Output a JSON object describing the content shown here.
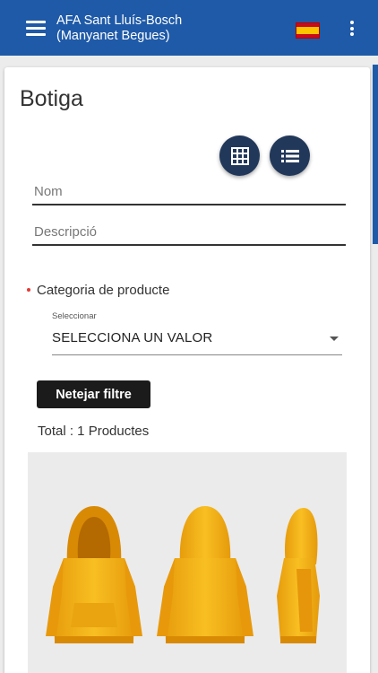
{
  "appbar": {
    "title_line1": "AFA Sant Lluís-Bosch",
    "title_line2": "(Manyanet Begues)",
    "flag_icon": "spain-flag-icon",
    "menu_icon": "hamburger-menu-icon",
    "more_icon": "more-vert-icon"
  },
  "page": {
    "title": "Botiga"
  },
  "view_buttons": {
    "grid_icon": "grid-view-icon",
    "list_icon": "list-view-icon"
  },
  "filters": {
    "name_placeholder": "Nom",
    "description_placeholder": "Descripció",
    "category_label": "Categoria de producte",
    "category_required": true,
    "select_label": "Seleccionar",
    "select_value": "SELECCIONA UN VALOR",
    "clear_button": "Netejar filtre"
  },
  "results": {
    "total_text": "Total : 1 Productes"
  },
  "colors": {
    "appbar": "#1f5aa8",
    "fab": "#22385a",
    "button": "#1b1b1b",
    "required": "#e53935",
    "hoodie": "#f5b417"
  }
}
